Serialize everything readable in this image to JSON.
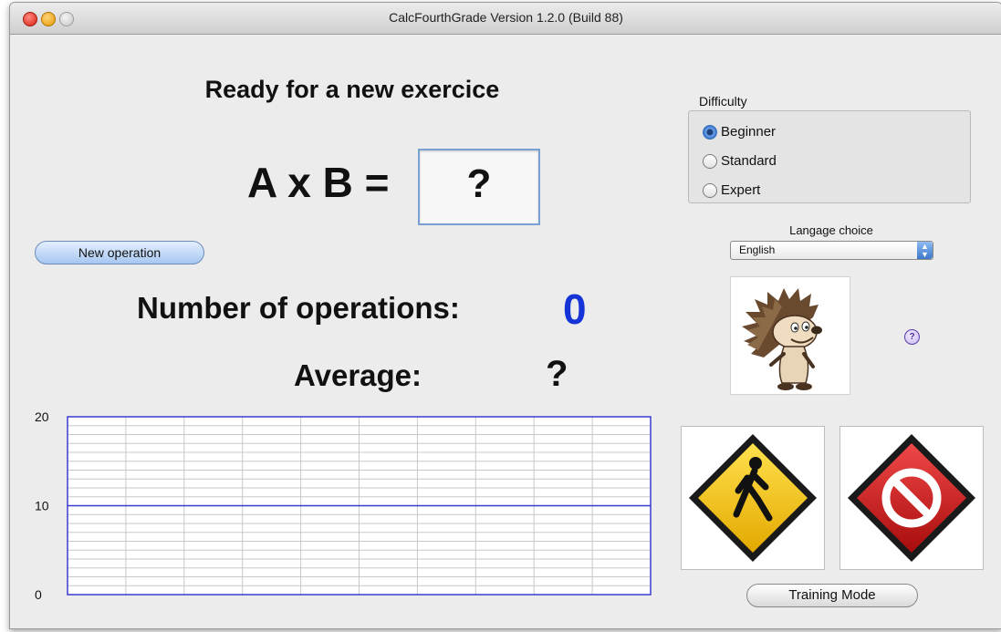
{
  "window": {
    "title": "CalcFourthGrade  Version 1.2.0 (Build 88)"
  },
  "status": {
    "heading": "Ready for a new exercice"
  },
  "exercise": {
    "formula": "A x B =",
    "answer": "?"
  },
  "buttons": {
    "new_operation": "New operation",
    "training_mode": "Training Mode"
  },
  "stats": {
    "operations_label": "Number of operations:",
    "operations_value": "0",
    "average_label": "Average:",
    "average_value": "?"
  },
  "chart_data": {
    "type": "line",
    "title": "",
    "xlabel": "",
    "ylabel": "",
    "ylim": [
      0,
      20
    ],
    "y_ticks": [
      "0",
      "10",
      "20"
    ],
    "reference_line": 10,
    "grid": true,
    "series": []
  },
  "difficulty": {
    "label": "Difficulty",
    "options": [
      "Beginner",
      "Standard",
      "Expert"
    ],
    "selected": "Beginner"
  },
  "language": {
    "label": "Langage choice",
    "selected": "English"
  },
  "help": {
    "symbol": "?"
  },
  "colors": {
    "count_blue": "#1533d6",
    "chart_blue": "#3a3ad0",
    "go_sign": "#f5c400",
    "stop_sign": "#d01818"
  },
  "icons": {
    "mascot": "hedgehog-mascot",
    "start": "pedestrian-warning-sign-icon",
    "stop": "no-entry-sign-icon"
  }
}
